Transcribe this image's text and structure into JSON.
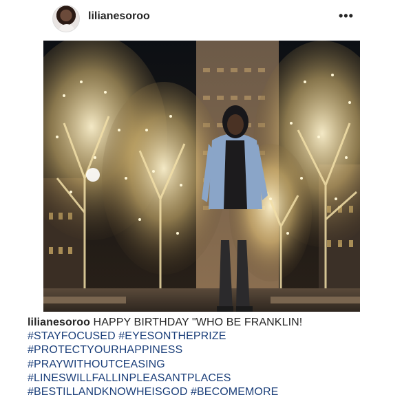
{
  "post": {
    "username": "lilianesoroo",
    "more_label": "•••",
    "caption_user": "lilianesoroo",
    "caption_text": "HAPPY BIRTHDAY \"WHO BE FRANKLIN!",
    "hashtags": [
      [
        "#STAYFOCUSED",
        "#EYESONTHEPRIZE"
      ],
      [
        "#PROTECTYOURHAPPINESS"
      ],
      [
        "#PRAYWITHOUTCEASING"
      ],
      [
        "#LINESWILLFALLINPLEASANTPLACES"
      ],
      [
        "#BESTILLANDKNOWHEISGOD",
        "#BECOMEMORE"
      ]
    ]
  },
  "colors": {
    "hashtag": "#1b3f7a",
    "text": "#262626"
  }
}
